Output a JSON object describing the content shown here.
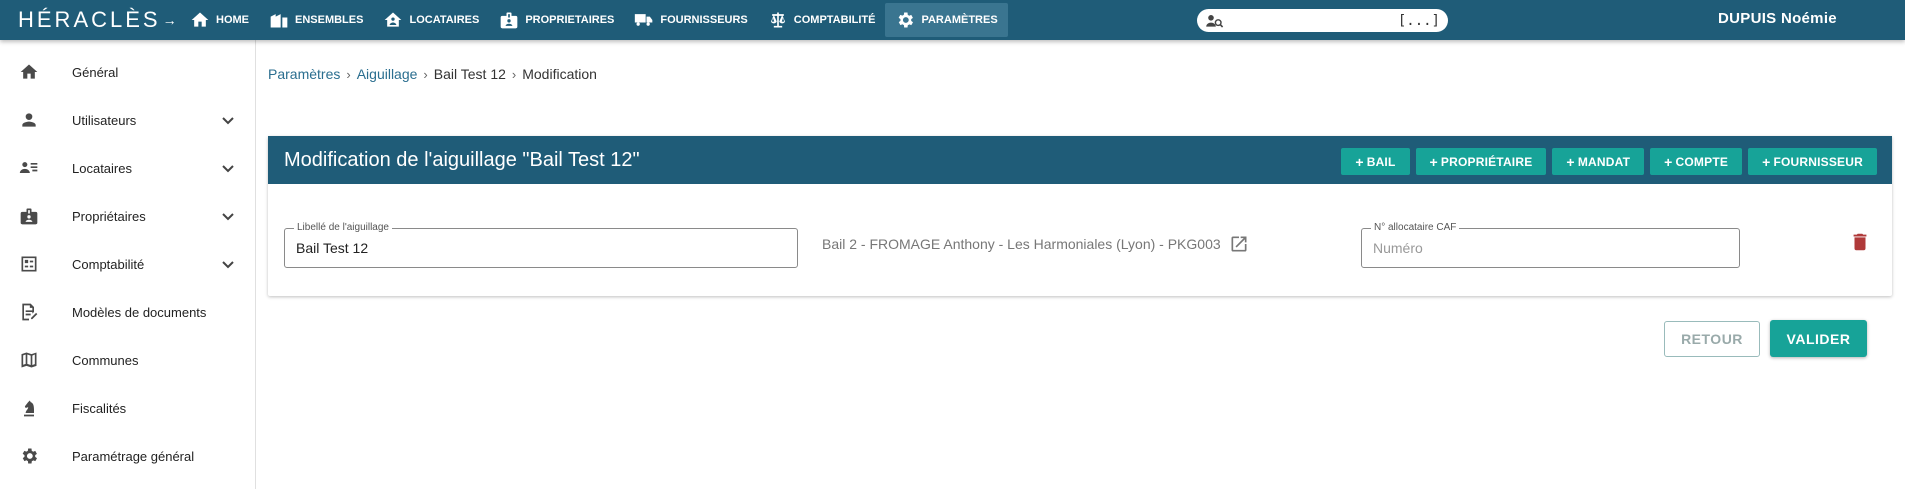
{
  "app": {
    "logo": "HÉRACLÈS"
  },
  "nav": [
    {
      "label": "HOME",
      "icon": "home-icon"
    },
    {
      "label": "ENSEMBLES",
      "icon": "buildings-icon"
    },
    {
      "label": "LOCATAIRES",
      "icon": "house-person-icon"
    },
    {
      "label": "PROPRIETAIRES",
      "icon": "badge-icon"
    },
    {
      "label": "FOURNISSEURS",
      "icon": "truck-icon"
    },
    {
      "label": "COMPTABILITÉ",
      "icon": "scale-icon"
    },
    {
      "label": "PARAMÈTRES",
      "icon": "gear-icon",
      "active": true
    }
  ],
  "search": {
    "placeholder": "",
    "shortcut": "[...]"
  },
  "user": {
    "name": "DUPUIS Noémie"
  },
  "sidebar": {
    "items": [
      {
        "label": "Général",
        "icon": "home-icon",
        "expandable": false
      },
      {
        "label": "Utilisateurs",
        "icon": "person-icon",
        "expandable": true
      },
      {
        "label": "Locataires",
        "icon": "contacts-list-icon",
        "expandable": true
      },
      {
        "label": "Propriétaires",
        "icon": "badge-icon",
        "expandable": true
      },
      {
        "label": "Comptabilité",
        "icon": "ledger-icon",
        "expandable": true
      },
      {
        "label": "Modèles de documents",
        "icon": "document-edit-icon",
        "expandable": false
      },
      {
        "label": "Communes",
        "icon": "map-icon",
        "expandable": false
      },
      {
        "label": "Fiscalités",
        "icon": "chess-knight-icon",
        "expandable": false
      },
      {
        "label": "Paramétrage général",
        "icon": "gear-icon",
        "expandable": false
      }
    ]
  },
  "breadcrumb": {
    "items": [
      "Paramètres",
      "Aiguillage",
      "Bail Test 12",
      "Modification"
    ]
  },
  "card": {
    "title": "Modification de l'aiguillage \"Bail Test 12\"",
    "buttons": [
      "BAIL",
      "PROPRIÉTAIRE",
      "MANDAT",
      "COMPTE",
      "FOURNISSEUR"
    ],
    "libelle_label": "Libellé de l'aiguillage",
    "libelle_value": "Bail Test 12",
    "bail_text": "Bail 2 - FROMAGE Anthony - Les Harmoniales (Lyon) - PKG003",
    "caf_label": "N° allocataire CAF",
    "caf_placeholder": "Numéro",
    "caf_value": ""
  },
  "actions": {
    "retour": "RETOUR",
    "valider": "VALIDER"
  }
}
